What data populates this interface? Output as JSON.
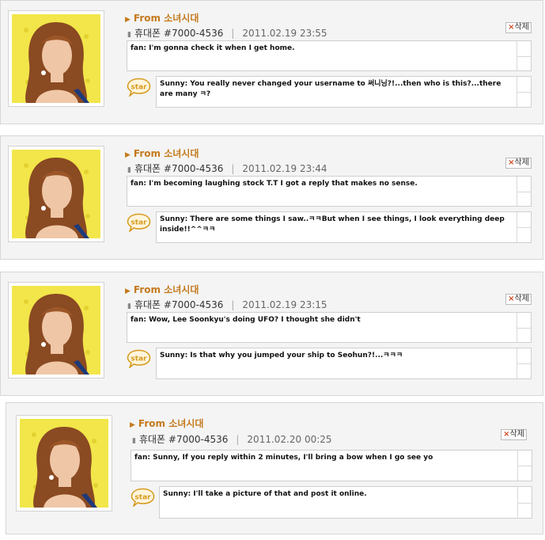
{
  "comments": [
    {
      "author": "From 소녀시대",
      "device": "휴대폰",
      "number": "#7000-4536",
      "date": "2011.02.19 23:55",
      "delete_label": "삭제",
      "fan_text": "fan: I'm gonna check it when I get home.",
      "reply_badge": "star",
      "reply_text": "Sunny: You really never changed your username to 써니닝?!...then who is this?...there are many ㅋ?"
    },
    {
      "author": "From 소녀시대",
      "device": "휴대폰",
      "number": "#7000-4536",
      "date": "2011.02.19 23:44",
      "delete_label": "삭제",
      "fan_text": "fan: I'm becoming laughing stock T.T I got a reply that makes no sense.",
      "reply_badge": "star",
      "reply_text": "Sunny: There are some things I saw..ㅋㅋBut when I see things, I look everything deep inside!!^^ㅋㅋ"
    },
    {
      "author": "From 소녀시대",
      "device": "휴대폰",
      "number": "#7000-4536",
      "date": "2011.02.19 23:15",
      "delete_label": "삭제",
      "fan_text": "fan: Wow, Lee Soonkyu's doing UFO? I thought she didn't",
      "reply_badge": "star",
      "reply_text": "Sunny: Is that why you jumped your ship to Seohun?!...ㅋㅋㅋ"
    },
    {
      "author": "From 소녀시대",
      "device": "휴대폰",
      "number": "#7000-4536",
      "date": "2011.02.20 00:25",
      "delete_label": "삭제",
      "fan_text": "fan: Sunny, If you reply within 2 minutes, I'll bring a bow when I go see yo",
      "reply_badge": "star",
      "reply_text": "Sunny: I'll take a picture of that and post it online."
    }
  ],
  "colors": {
    "author": "#c47a1e",
    "star_badge": "#d59a1c",
    "avatar_background": "#f2e64a"
  },
  "icons": {
    "author_marker": "triangle-right-icon",
    "phone_marker": "phone-icon",
    "delete_marker": "x-icon"
  }
}
